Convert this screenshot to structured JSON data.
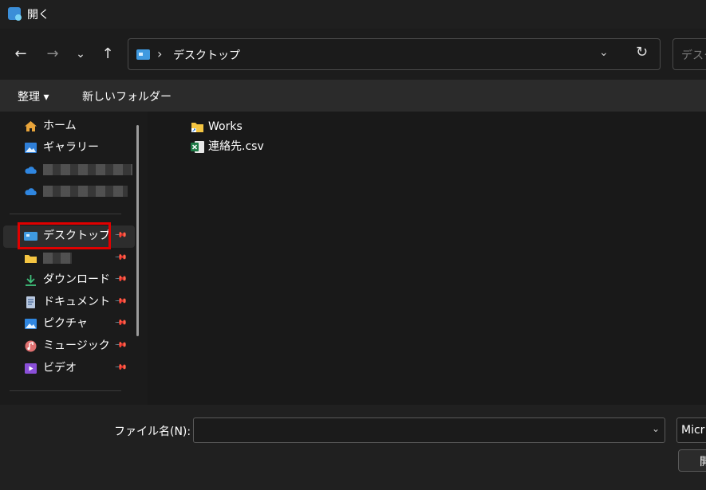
{
  "window": {
    "title": "開く"
  },
  "nav": {
    "back_icon": "←",
    "forward_icon": "→",
    "recent_icon": "⌄",
    "up_icon": "↑"
  },
  "address": {
    "separator": "›",
    "location": "デスクトップ",
    "dropdown_icon": "⌄",
    "refresh_icon": "↻"
  },
  "search": {
    "placeholder": "デスク"
  },
  "toolbar": {
    "organize_label": "整理 ▾",
    "new_folder_label": "新しいフォルダー"
  },
  "sidebar": {
    "home": "ホーム",
    "gallery": "ギャラリー",
    "desktop": "デスクトップ",
    "downloads": "ダウンロード",
    "documents": "ドキュメント",
    "pictures": "ピクチャ",
    "music": "ミュージック",
    "videos": "ビデオ"
  },
  "files": [
    {
      "name": "Works"
    },
    {
      "name": "連絡先.csv"
    }
  ],
  "bottom": {
    "filename_label": "ファイル名(N):",
    "filename_value": "",
    "filetype_value": "Micr",
    "open_label": "開"
  },
  "colors": {
    "highlight": "#e00000",
    "accent": "#3f9ae0"
  }
}
